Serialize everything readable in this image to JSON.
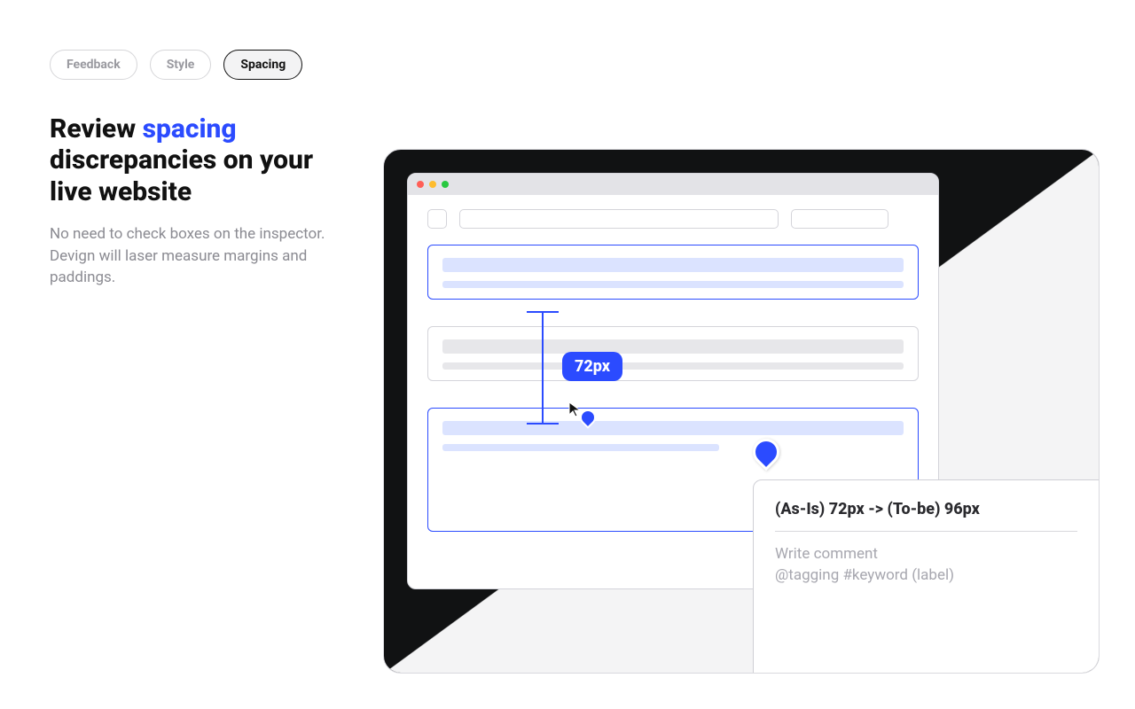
{
  "tabs": {
    "items": [
      {
        "label": "Feedback",
        "active": false
      },
      {
        "label": "Style",
        "active": false
      },
      {
        "label": "Spacing",
        "active": true
      }
    ]
  },
  "copy": {
    "headline_pre": "Review ",
    "headline_accent": "spacing",
    "headline_post": " discrepancies on your live website",
    "subtext": "No need to check boxes on the inspector. Devign will laser measure margins and paddings."
  },
  "illustration": {
    "measurement_label": "72px",
    "comment_title": "(As-Is) 72px -> (To-be) 96px",
    "comment_placeholder": "Write comment\n@tagging #keyword (label)"
  }
}
